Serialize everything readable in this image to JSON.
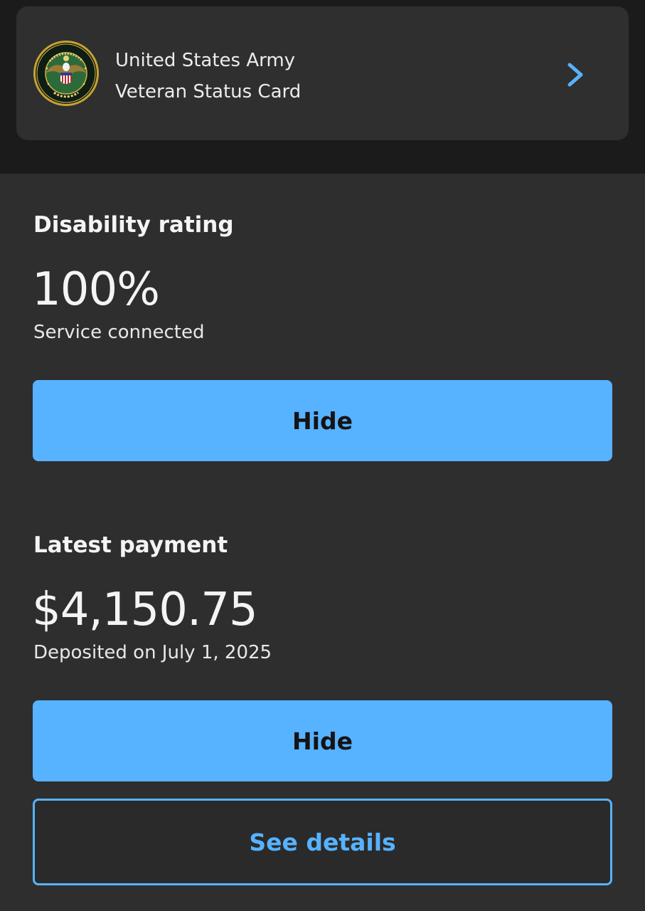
{
  "veteran_card": {
    "title_line1": "United States Army",
    "title_line2": "Veteran Status Card",
    "emblem": "army-seal",
    "action_icon": "chevron-right-icon"
  },
  "disability_rating": {
    "heading": "Disability rating",
    "value": "100%",
    "description": "Service connected",
    "hide_label": "Hide"
  },
  "latest_payment": {
    "heading": "Latest payment",
    "amount": "$4,150.75",
    "description": "Deposited on July 1, 2025",
    "hide_label": "Hide",
    "details_label": "See details"
  },
  "colors": {
    "background": "#2e2e2e",
    "top_band": "#1b1b1b",
    "card": "#2f2f2f",
    "accent": "#57b2ff",
    "text": "#f4f4f4"
  }
}
